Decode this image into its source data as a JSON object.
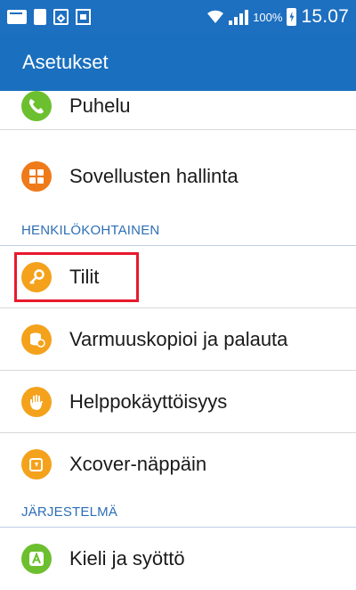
{
  "status_bar": {
    "battery_percent": "100%",
    "time": "15.07",
    "icons": [
      "email-icon",
      "document-icon",
      "sd-card-icon",
      "calendar-icon",
      "wifi-icon",
      "signal-icon",
      "battery-charging-icon"
    ]
  },
  "app_bar": {
    "title": "Asetukset"
  },
  "colors": {
    "app_bar": "#1a6fbe",
    "section_text": "#2d6fb5",
    "highlight": "#e8192c",
    "green": "#6cbf2e",
    "orange": "#ef7a1a",
    "amber": "#f4a21c"
  },
  "items": [
    {
      "label": "Puhelu",
      "icon": "phone-icon"
    },
    {
      "label": "Sovellusten hallinta",
      "icon": "apps-grid-icon"
    },
    {
      "label": "Tilit",
      "icon": "key-icon"
    },
    {
      "label": "Varmuuskopioi ja palauta",
      "icon": "backup-icon"
    },
    {
      "label": "Helppokäyttöisyys",
      "icon": "hand-icon"
    },
    {
      "label": "Xcover-näppäin",
      "icon": "xcover-key-icon"
    },
    {
      "label": "Kieli ja syöttö",
      "icon": "language-icon"
    }
  ],
  "sections": {
    "personal": "HENKILÖKOHTAINEN",
    "system": "JÄRJESTELMÄ"
  }
}
